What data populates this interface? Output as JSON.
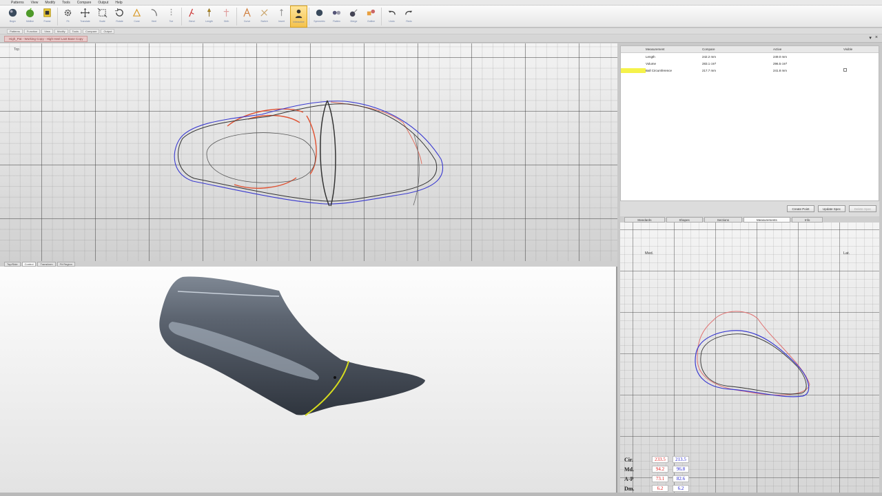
{
  "menu": [
    "Patterns",
    "View",
    "Modify",
    "Tools",
    "Compare",
    "Output",
    "Help"
  ],
  "ribbon": [
    {
      "label": "Begin",
      "icon": "sphere-icon"
    },
    {
      "label": "Midline",
      "icon": "apple-icon"
    },
    {
      "label": "Frame",
      "icon": "frame-icon"
    },
    {
      "label": "Fit",
      "icon": "gear-icon"
    },
    {
      "label": "Translate",
      "icon": "move-icon"
    },
    {
      "label": "Scale",
      "icon": "scale-icon"
    },
    {
      "label": "Rotate",
      "icon": "rotate-icon"
    },
    {
      "label": "Cone",
      "icon": "cone-icon"
    },
    {
      "label": "Heel",
      "icon": "heel-icon"
    },
    {
      "label": "Toe",
      "icon": "toe-icon"
    },
    {
      "label": "Bend",
      "icon": "bend-icon"
    },
    {
      "label": "Length",
      "icon": "length-icon"
    },
    {
      "label": "Girth",
      "icon": "girth-icon"
    },
    {
      "label": "Curve",
      "icon": "curve-icon"
    },
    {
      "label": "Switch",
      "icon": "switch-icon"
    },
    {
      "label": "Insert",
      "icon": "insert-icon"
    },
    {
      "label": "Interactive",
      "icon": "person-icon"
    },
    {
      "label": "Symmetric",
      "icon": "symmetric-icon"
    },
    {
      "label": "Flatten",
      "icon": "flatten-icon"
    },
    {
      "label": "Merge",
      "icon": "merge-icon"
    },
    {
      "label": "Outline",
      "icon": "outline-icon"
    },
    {
      "label": "Undo",
      "icon": "undo-icon"
    },
    {
      "label": "Redo",
      "icon": "redo-icon"
    }
  ],
  "tabstrip": [
    "Patterns",
    "Function",
    "View",
    "Modify",
    "Tools",
    "Compare",
    "Output"
  ],
  "document_tab": "High_Pat - Working Copy - High Heel Last Base Copy",
  "viewport_top_label": "Top",
  "viewport_tabs": [
    "Top/Side",
    "Control",
    "Transform",
    "Fit Region"
  ],
  "measurements": {
    "headers": [
      "Measurement",
      "Compare",
      "Active",
      "Visible"
    ],
    "rows": [
      {
        "name": "Length",
        "compare": "242.2 mm",
        "active": "249.0 mm",
        "highlight": false,
        "visible": false
      },
      {
        "name": "Volume",
        "compare": "283.1 cm³",
        "active": "296.5 cm³",
        "highlight": false,
        "visible": false
      },
      {
        "name": "Ball Circumference",
        "compare": "217.7 mm",
        "active": "241.8 mm",
        "highlight": true,
        "visible": true
      }
    ]
  },
  "panel_buttons": [
    "Create Point",
    "Update Spec",
    "Delete Spec"
  ],
  "panel_tabs": [
    "Standards",
    "Shapes",
    "Sections",
    "Measurements",
    "Info"
  ],
  "section_view": {
    "left": "Med.",
    "right": "Lat."
  },
  "readouts": [
    {
      "label": "Cir.",
      "compare": "233.5",
      "active": "213.5"
    },
    {
      "label": "Md.",
      "compare": "94.2",
      "active": "96.8"
    },
    {
      "label": "A-P",
      "compare": "73.1",
      "active": "82.6"
    },
    {
      "label": "Dm.",
      "compare": "6.2",
      "active": "6.2"
    }
  ],
  "colors": {
    "compare_line": "#e05030",
    "active_line": "#3a3ad0",
    "highlight": "#f5f24a",
    "girth_line": "#d6dc1e"
  }
}
